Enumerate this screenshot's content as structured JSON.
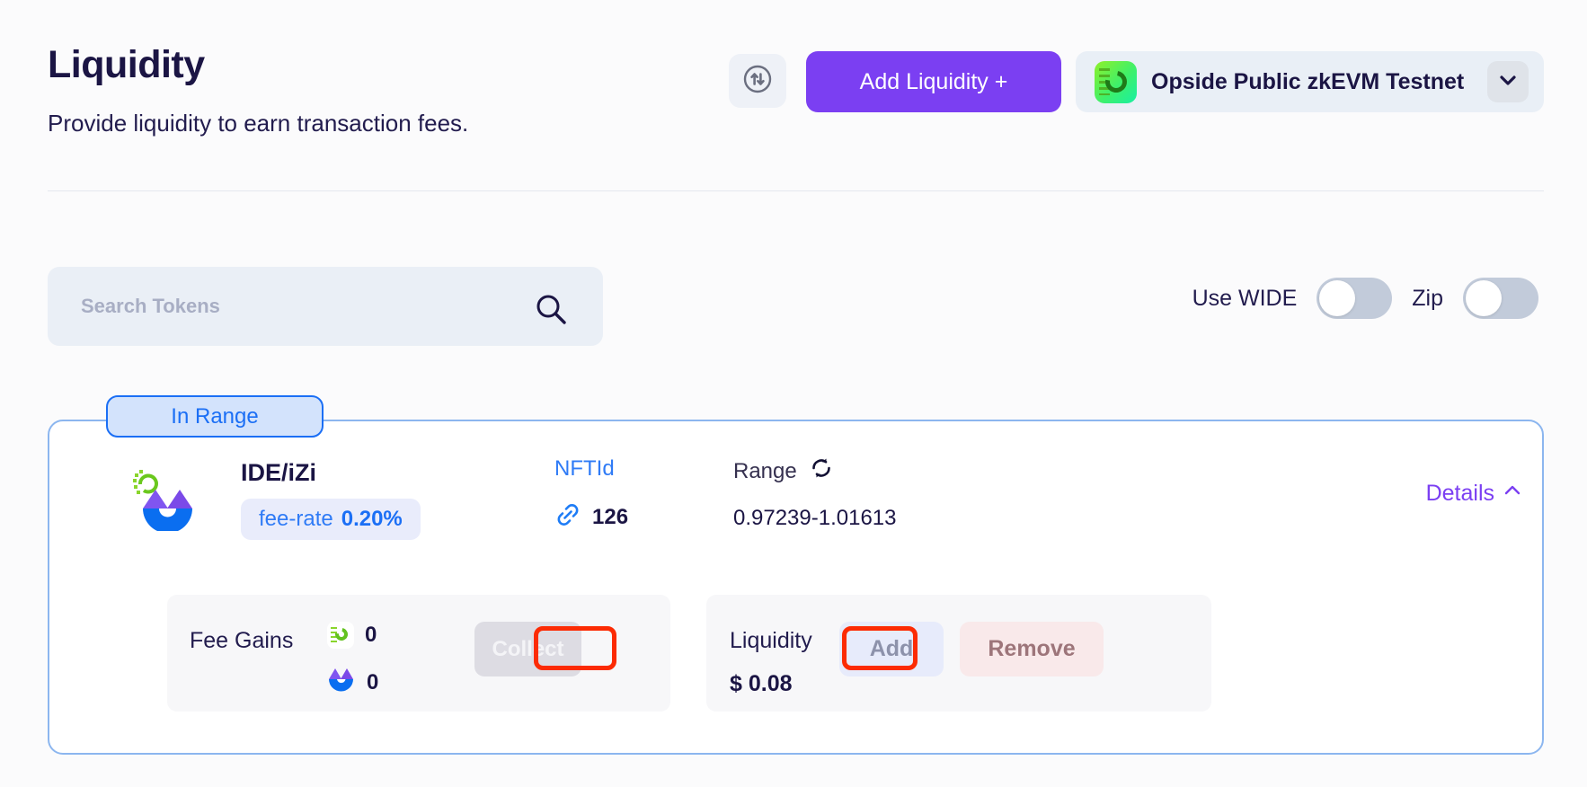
{
  "header": {
    "title": "Liquidity",
    "subtitle": "Provide liquidity to earn transaction fees.",
    "swap_icon": "swap-vertical-icon",
    "add_liquidity_label": "Add Liquidity +",
    "network": {
      "name": "Opside Public zkEVM Testnet",
      "logo_icon": "opside-logo-icon",
      "chevron_icon": "chevron-down-icon"
    },
    "accent_purple": "#7b3ff2"
  },
  "controls": {
    "search": {
      "placeholder": "Search Tokens",
      "value": "",
      "icon": "search-icon"
    },
    "toggles": [
      {
        "label": "Use WIDE",
        "on": false
      },
      {
        "label": "Zip",
        "on": false
      }
    ]
  },
  "position": {
    "status_badge": "In Range",
    "status_color": "#1b6ff5",
    "pair_icon": "ide-izi-pair-icon",
    "pair_name": "IDE/iZi",
    "fee_rate_label": "fee-rate",
    "fee_rate_value": "0.20%",
    "nft": {
      "header": "NFTId",
      "link_icon": "link-icon",
      "id": "126"
    },
    "range": {
      "header": "Range",
      "refresh_icon": "refresh-swap-icon",
      "value": "0.97239-1.01613"
    },
    "details": {
      "label": "Details",
      "chevron_icon": "chevron-up-icon"
    },
    "fee_gains": {
      "label": "Fee Gains",
      "rows": [
        {
          "token_icon": "ide-token-icon",
          "amount": "0"
        },
        {
          "token_icon": "izi-token-icon",
          "amount": "0"
        }
      ],
      "collect_label": "Collect",
      "collect_disabled": true
    },
    "liquidity": {
      "label": "Liquidity",
      "value": "$ 0.08",
      "add_label": "Add",
      "remove_label": "Remove"
    }
  },
  "annotations": {
    "color": "#fc2b04",
    "targets": [
      "collect-button",
      "add-button"
    ]
  }
}
